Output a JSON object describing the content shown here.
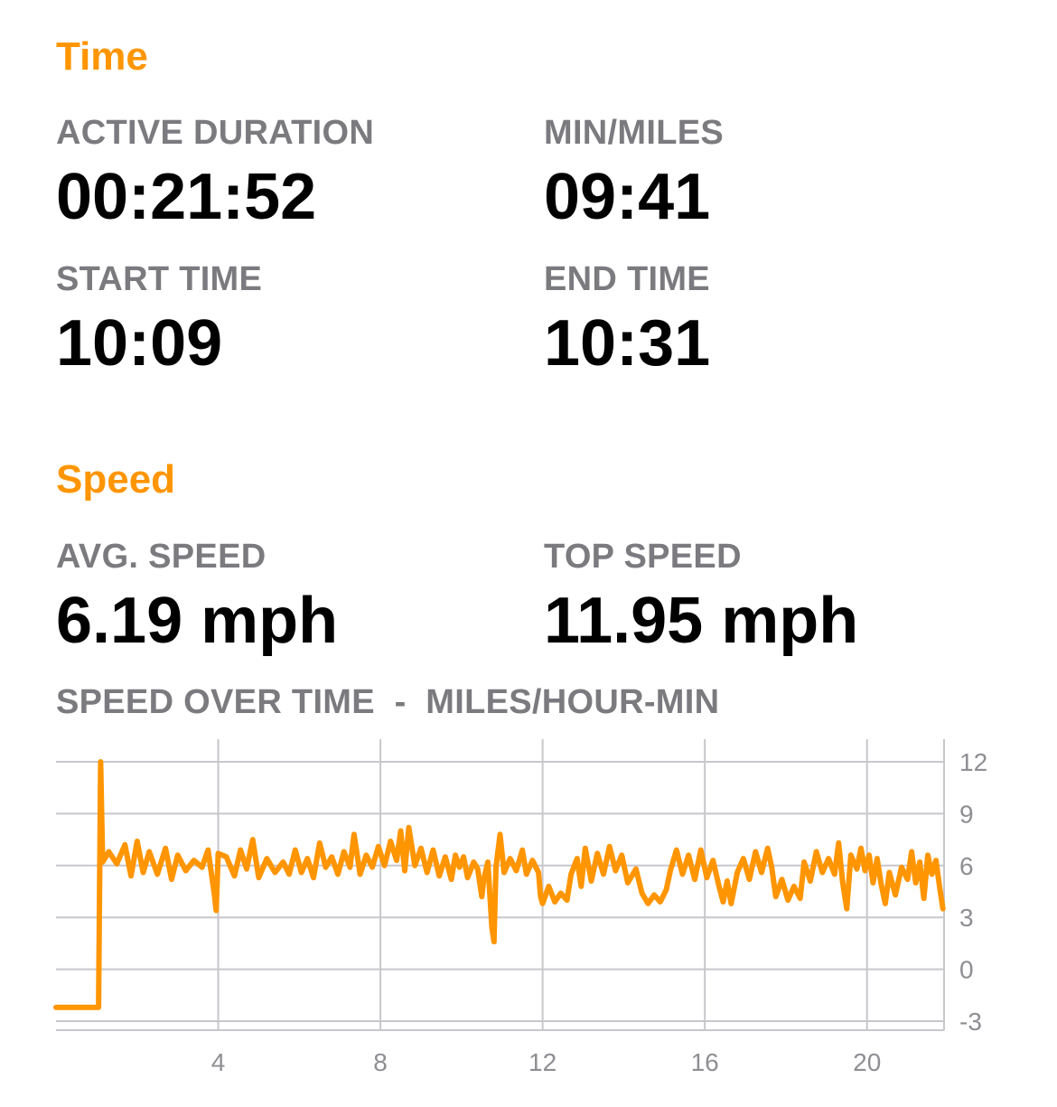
{
  "colors": {
    "accent": "#ff9500",
    "label_gray": "#7b7b7f",
    "value_black": "#000000",
    "grid": "#c7c7cc"
  },
  "time_section": {
    "title": "Time",
    "active_duration_label": "ACTIVE DURATION",
    "active_duration_value": "00:21:52",
    "pace_label": "MIN/MILES",
    "pace_value": "09:41",
    "start_time_label": "START TIME",
    "start_time_value": "10:09",
    "end_time_label": "END TIME",
    "end_time_value": "10:31"
  },
  "speed_section": {
    "title": "Speed",
    "avg_speed_label": "AVG. SPEED",
    "avg_speed_value": "6.19 mph",
    "top_speed_label": "TOP SPEED",
    "top_speed_value": "11.95 mph",
    "chart_title": "SPEED OVER TIME  -  MILES/HOUR-MIN"
  },
  "chart_data": {
    "type": "line",
    "title": "SPEED OVER TIME  -  MILES/HOUR-MIN",
    "xlabel": "",
    "ylabel": "",
    "xlim": [
      0,
      21.9
    ],
    "ylim": [
      -3,
      12
    ],
    "x_ticks": [
      4,
      8,
      12,
      16,
      20
    ],
    "y_ticks": [
      12,
      9,
      6,
      3,
      0,
      -3
    ],
    "y_axis_side": "right",
    "grid": true,
    "series": [
      {
        "color": "#ff9500",
        "points": [
          [
            0.0,
            -2.2
          ],
          [
            1.05,
            -2.2
          ],
          [
            1.1,
            12.0
          ],
          [
            1.15,
            6.2
          ],
          [
            1.3,
            6.8
          ],
          [
            1.5,
            6.1
          ],
          [
            1.7,
            7.2
          ],
          [
            1.85,
            5.4
          ],
          [
            2.0,
            7.4
          ],
          [
            2.15,
            5.6
          ],
          [
            2.3,
            6.8
          ],
          [
            2.5,
            5.5
          ],
          [
            2.7,
            7.0
          ],
          [
            2.85,
            5.2
          ],
          [
            3.0,
            6.6
          ],
          [
            3.2,
            5.7
          ],
          [
            3.4,
            6.3
          ],
          [
            3.6,
            5.9
          ],
          [
            3.75,
            6.9
          ],
          [
            3.9,
            4.4
          ],
          [
            3.95,
            3.4
          ],
          [
            4.0,
            6.7
          ],
          [
            4.2,
            6.5
          ],
          [
            4.4,
            5.4
          ],
          [
            4.55,
            6.9
          ],
          [
            4.7,
            5.8
          ],
          [
            4.85,
            7.5
          ],
          [
            5.0,
            5.3
          ],
          [
            5.2,
            6.4
          ],
          [
            5.4,
            5.6
          ],
          [
            5.6,
            6.2
          ],
          [
            5.75,
            5.5
          ],
          [
            5.9,
            6.9
          ],
          [
            6.05,
            5.6
          ],
          [
            6.2,
            6.4
          ],
          [
            6.35,
            5.3
          ],
          [
            6.5,
            7.3
          ],
          [
            6.65,
            5.9
          ],
          [
            6.8,
            6.5
          ],
          [
            6.95,
            5.5
          ],
          [
            7.1,
            6.8
          ],
          [
            7.25,
            5.9
          ],
          [
            7.35,
            7.8
          ],
          [
            7.5,
            5.5
          ],
          [
            7.65,
            6.6
          ],
          [
            7.8,
            5.9
          ],
          [
            7.95,
            7.1
          ],
          [
            8.1,
            6.0
          ],
          [
            8.25,
            7.4
          ],
          [
            8.4,
            6.3
          ],
          [
            8.5,
            8.0
          ],
          [
            8.6,
            5.7
          ],
          [
            8.7,
            8.2
          ],
          [
            8.85,
            6.0
          ],
          [
            9.0,
            7.0
          ],
          [
            9.15,
            5.6
          ],
          [
            9.3,
            6.9
          ],
          [
            9.45,
            5.4
          ],
          [
            9.6,
            6.5
          ],
          [
            9.75,
            5.2
          ],
          [
            9.85,
            6.6
          ],
          [
            9.95,
            5.9
          ],
          [
            10.05,
            6.5
          ],
          [
            10.15,
            5.3
          ],
          [
            10.3,
            6.2
          ],
          [
            10.4,
            5.8
          ],
          [
            10.5,
            4.2
          ],
          [
            10.55,
            5.2
          ],
          [
            10.65,
            6.2
          ],
          [
            10.75,
            2.4
          ],
          [
            10.8,
            1.6
          ],
          [
            10.85,
            5.9
          ],
          [
            10.95,
            7.8
          ],
          [
            11.05,
            5.6
          ],
          [
            11.2,
            6.4
          ],
          [
            11.35,
            5.7
          ],
          [
            11.5,
            6.9
          ],
          [
            11.6,
            5.5
          ],
          [
            11.75,
            6.3
          ],
          [
            11.9,
            5.6
          ],
          [
            11.95,
            4.2
          ],
          [
            12.0,
            3.8
          ],
          [
            12.15,
            4.8
          ],
          [
            12.3,
            3.9
          ],
          [
            12.45,
            4.4
          ],
          [
            12.6,
            4.0
          ],
          [
            12.7,
            5.5
          ],
          [
            12.85,
            6.4
          ],
          [
            12.95,
            4.8
          ],
          [
            13.05,
            7.0
          ],
          [
            13.2,
            5.1
          ],
          [
            13.35,
            6.7
          ],
          [
            13.5,
            5.5
          ],
          [
            13.65,
            7.1
          ],
          [
            13.8,
            5.7
          ],
          [
            13.95,
            6.6
          ],
          [
            14.1,
            5.0
          ],
          [
            14.3,
            5.8
          ],
          [
            14.45,
            4.4
          ],
          [
            14.6,
            3.8
          ],
          [
            14.75,
            4.3
          ],
          [
            14.9,
            3.9
          ],
          [
            15.05,
            4.6
          ],
          [
            15.15,
            5.7
          ],
          [
            15.3,
            6.9
          ],
          [
            15.45,
            5.5
          ],
          [
            15.6,
            6.6
          ],
          [
            15.75,
            5.2
          ],
          [
            15.9,
            6.9
          ],
          [
            16.05,
            5.3
          ],
          [
            16.2,
            6.3
          ],
          [
            16.35,
            4.8
          ],
          [
            16.45,
            3.9
          ],
          [
            16.55,
            5.1
          ],
          [
            16.65,
            3.8
          ],
          [
            16.8,
            5.6
          ],
          [
            16.95,
            6.4
          ],
          [
            17.1,
            5.2
          ],
          [
            17.25,
            6.8
          ],
          [
            17.4,
            5.6
          ],
          [
            17.55,
            7.0
          ],
          [
            17.65,
            5.9
          ],
          [
            17.75,
            4.2
          ],
          [
            17.9,
            5.2
          ],
          [
            18.05,
            4.0
          ],
          [
            18.2,
            4.8
          ],
          [
            18.35,
            4.1
          ],
          [
            18.45,
            6.2
          ],
          [
            18.6,
            5.1
          ],
          [
            18.75,
            6.8
          ],
          [
            18.9,
            5.6
          ],
          [
            19.05,
            6.4
          ],
          [
            19.2,
            5.5
          ],
          [
            19.3,
            7.3
          ],
          [
            19.4,
            5.0
          ],
          [
            19.5,
            3.5
          ],
          [
            19.6,
            6.6
          ],
          [
            19.75,
            5.8
          ],
          [
            19.85,
            7.0
          ],
          [
            19.95,
            5.7
          ],
          [
            20.05,
            6.6
          ],
          [
            20.15,
            5.0
          ],
          [
            20.25,
            6.4
          ],
          [
            20.35,
            4.9
          ],
          [
            20.45,
            3.8
          ],
          [
            20.55,
            5.6
          ],
          [
            20.7,
            4.3
          ],
          [
            20.85,
            5.9
          ],
          [
            21.0,
            5.2
          ],
          [
            21.1,
            6.8
          ],
          [
            21.2,
            5.0
          ],
          [
            21.3,
            6.2
          ],
          [
            21.4,
            4.1
          ],
          [
            21.5,
            6.6
          ],
          [
            21.6,
            5.5
          ],
          [
            21.7,
            6.3
          ],
          [
            21.8,
            4.6
          ],
          [
            21.87,
            3.5
          ]
        ]
      }
    ]
  }
}
